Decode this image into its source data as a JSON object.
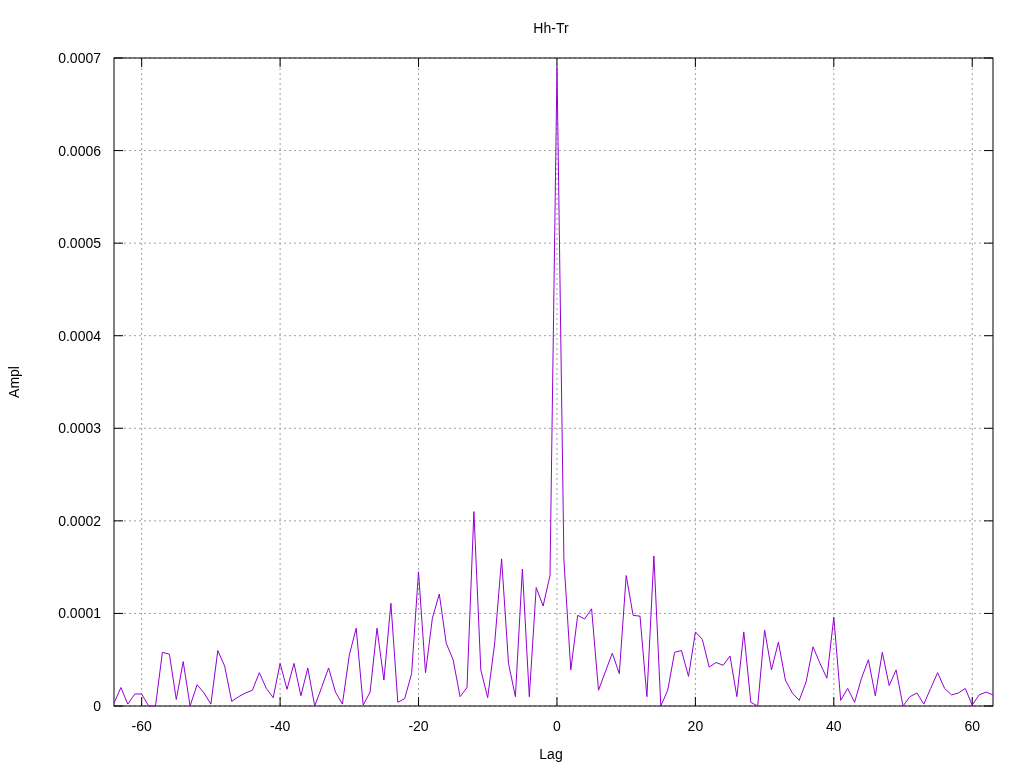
{
  "plot": {
    "chart_data": {
      "type": "line",
      "title": "Hh-Tr",
      "xlabel": "Lag",
      "ylabel": "Ampl",
      "grid": true,
      "xlim": [
        -64,
        63
      ],
      "ylim": [
        0,
        0.0007
      ],
      "xticks": [
        -60,
        -40,
        -20,
        0,
        20,
        40,
        60
      ],
      "yticks": [
        {
          "value": 0,
          "label": "0"
        },
        {
          "value": 0.0001,
          "label": "0.0001"
        },
        {
          "value": 0.0002,
          "label": "0.0002"
        },
        {
          "value": 0.0003,
          "label": "0.0003"
        },
        {
          "value": 0.0004,
          "label": "0.0004"
        },
        {
          "value": 0.0005,
          "label": "0.0005"
        },
        {
          "value": 0.0006,
          "label": "0.0006"
        },
        {
          "value": 0.0007,
          "label": "0.0007"
        }
      ],
      "x": [
        -64,
        -63,
        -62,
        -61,
        -60,
        -59,
        -58,
        -57,
        -56,
        -55,
        -54,
        -53,
        -52,
        -51,
        -50,
        -49,
        -48,
        -47,
        -46,
        -45,
        -44,
        -43,
        -42,
        -41,
        -40,
        -39,
        -38,
        -37,
        -36,
        -35,
        -34,
        -33,
        -32,
        -31,
        -30,
        -29,
        -28,
        -27,
        -26,
        -25,
        -24,
        -23,
        -22,
        -21,
        -20,
        -19,
        -18,
        -17,
        -16,
        -15,
        -14,
        -13,
        -12,
        -11,
        -10,
        -9,
        -8,
        -7,
        -6,
        -5,
        -4,
        -3,
        -2,
        -1,
        0,
        1,
        2,
        3,
        4,
        5,
        6,
        7,
        8,
        9,
        10,
        11,
        12,
        13,
        14,
        15,
        16,
        17,
        18,
        19,
        20,
        21,
        22,
        23,
        24,
        25,
        26,
        27,
        28,
        29,
        30,
        31,
        32,
        33,
        34,
        35,
        36,
        37,
        38,
        39,
        40,
        41,
        42,
        43,
        44,
        45,
        46,
        47,
        48,
        49,
        50,
        51,
        52,
        53,
        54,
        55,
        56,
        57,
        58,
        59,
        60,
        61,
        62,
        63
      ],
      "series": [
        {
          "color": "#9400d3",
          "values": [
            3e-06,
            2e-05,
            2e-06,
            1.3e-05,
            1.3e-05,
            0,
            0,
            5.8e-05,
            5.6e-05,
            7e-06,
            4.8e-05,
            0,
            2.3e-05,
            1.4e-05,
            2e-06,
            6e-05,
            4.3e-05,
            5e-06,
            1e-05,
            1.4e-05,
            1.7e-05,
            3.6e-05,
            1.9e-05,
            9e-06,
            4.6e-05,
            1.8e-05,
            4.6e-05,
            1.1e-05,
            4.1e-05,
            0,
            2e-05,
            4.1e-05,
            1.5e-05,
            2e-06,
            5.5e-05,
            8.4e-05,
            1e-06,
            1.5e-05,
            8.4e-05,
            2.8e-05,
            0.000111,
            4e-06,
            8e-06,
            3.5e-05,
            0.000145,
            3.6e-05,
            9.5e-05,
            0.000121,
            6.8e-05,
            5e-05,
            1e-05,
            2e-05,
            0.00021,
            3.9e-05,
            9e-06,
            6.8e-05,
            0.000159,
            4.6e-05,
            1e-05,
            0.000148,
            1e-05,
            0.000128,
            0.000108,
            0.000141,
            0.00069,
            0.000158,
            3.9e-05,
            9.8e-05,
            9.4e-05,
            0.000105,
            1.7e-05,
            3.7e-05,
            5.7e-05,
            3.5e-05,
            0.000141,
            9.8e-05,
            9.7e-05,
            1e-05,
            0.000162,
            0,
            1.7e-05,
            5.8e-05,
            6e-05,
            3.2e-05,
            8e-05,
            7.2e-05,
            4.2e-05,
            4.7e-05,
            4.4e-05,
            5.4e-05,
            1e-05,
            8e-05,
            4e-06,
            0,
            8.2e-05,
            3.9e-05,
            6.9e-05,
            2.8e-05,
            1.4e-05,
            6e-06,
            2.6e-05,
            6.4e-05,
            4.6e-05,
            3e-05,
            9.6e-05,
            6e-06,
            1.9e-05,
            4e-06,
            3e-05,
            5e-05,
            1.1e-05,
            5.8e-05,
            2.2e-05,
            3.9e-05,
            0,
            1e-05,
            1.4e-05,
            2e-06,
            1.9e-05,
            3.6e-05,
            1.9e-05,
            1.2e-05,
            1.4e-05,
            1.9e-05,
            1e-06,
            1.2e-05,
            1.5e-05,
            1.2e-05
          ]
        }
      ]
    }
  }
}
